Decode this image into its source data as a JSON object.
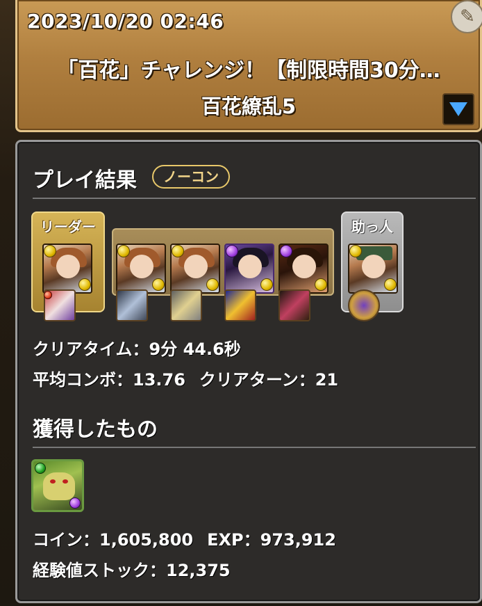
{
  "header": {
    "datetime": "2023/10/20 02:46",
    "dungeon_title": "「百花」チャレンジ！【制限時間30分…",
    "floor_title": "百花繚乱5",
    "edit_icon": "pencil-icon",
    "dropdown_icon": "triangle-down-icon",
    "accent_color": "#4aa8ff"
  },
  "result": {
    "title": "プレイ結果",
    "badge": "ノーコン",
    "leader_label": "リーダー",
    "helper_label": "助っ人",
    "clear_time_label": "クリアタイム：9分 44.6秒",
    "avg_combo_label": "平均コンボ：13.76",
    "clear_turn_label": "クリアターン：21"
  },
  "rewards": {
    "title": "獲得したもの",
    "coin_label": "コイン：1,605,800",
    "exp_label": "EXP：973,912",
    "stock_label": "経験値ストック：12,375"
  }
}
